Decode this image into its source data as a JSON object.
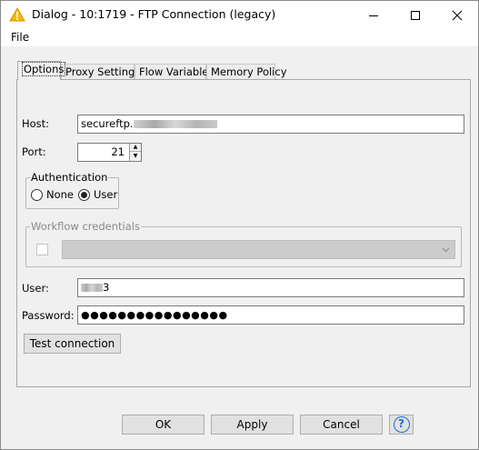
{
  "window": {
    "title": "Dialog - 10:1719 - FTP Connection (legacy)",
    "icon": "warning-triangle-icon",
    "accent_color": "#f3b800"
  },
  "menu": {
    "file_label": "File"
  },
  "tabs": [
    {
      "label": "Options",
      "active": true
    },
    {
      "label": "Proxy Settings",
      "active": false
    },
    {
      "label": "Flow Variables",
      "active": false
    },
    {
      "label": "Memory Policy",
      "active": false
    }
  ],
  "form": {
    "host_label": "Host:",
    "host_value": "secureftp.",
    "port_label": "Port:",
    "port_value": "21",
    "authentication": {
      "legend": "Authentication",
      "options": [
        {
          "label": "None",
          "selected": false
        },
        {
          "label": "User",
          "selected": true
        }
      ]
    },
    "workflow_credentials": {
      "legend": "Workflow credentials",
      "enabled": false,
      "checked": false,
      "selected_value": ""
    },
    "user_label": "User:",
    "user_value_suffix": "3",
    "password_label": "Password:",
    "password_value": "●●●●●●●●●●●●●●●●",
    "test_connection_label": "Test connection"
  },
  "footer": {
    "ok_label": "OK",
    "apply_label": "Apply",
    "cancel_label": "Cancel",
    "help_icon": "help-icon",
    "help_glyph": "?"
  }
}
